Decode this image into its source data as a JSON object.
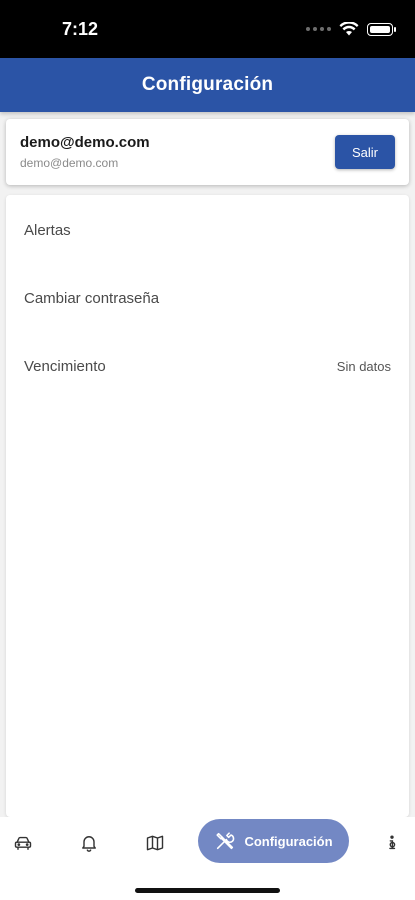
{
  "status_bar": {
    "time": "7:12"
  },
  "app_bar": {
    "title": "Configuración"
  },
  "account": {
    "email": "demo@demo.com",
    "subtitle": "demo@demo.com",
    "logout_label": "Salir"
  },
  "settings": {
    "items": [
      {
        "label": "Alertas",
        "value": ""
      },
      {
        "label": "Cambiar contraseña",
        "value": ""
      },
      {
        "label": "Vencimiento",
        "value": "Sin datos"
      }
    ]
  },
  "bottom_nav": {
    "items": [
      {
        "icon": "car-icon"
      },
      {
        "icon": "bell-icon"
      },
      {
        "icon": "map-icon"
      },
      {
        "icon": "tools-icon",
        "label": "Configuración",
        "active": true
      },
      {
        "icon": "info-icon"
      }
    ]
  },
  "colors": {
    "primary": "#2b54a6",
    "active_nav": "#7388c4"
  }
}
